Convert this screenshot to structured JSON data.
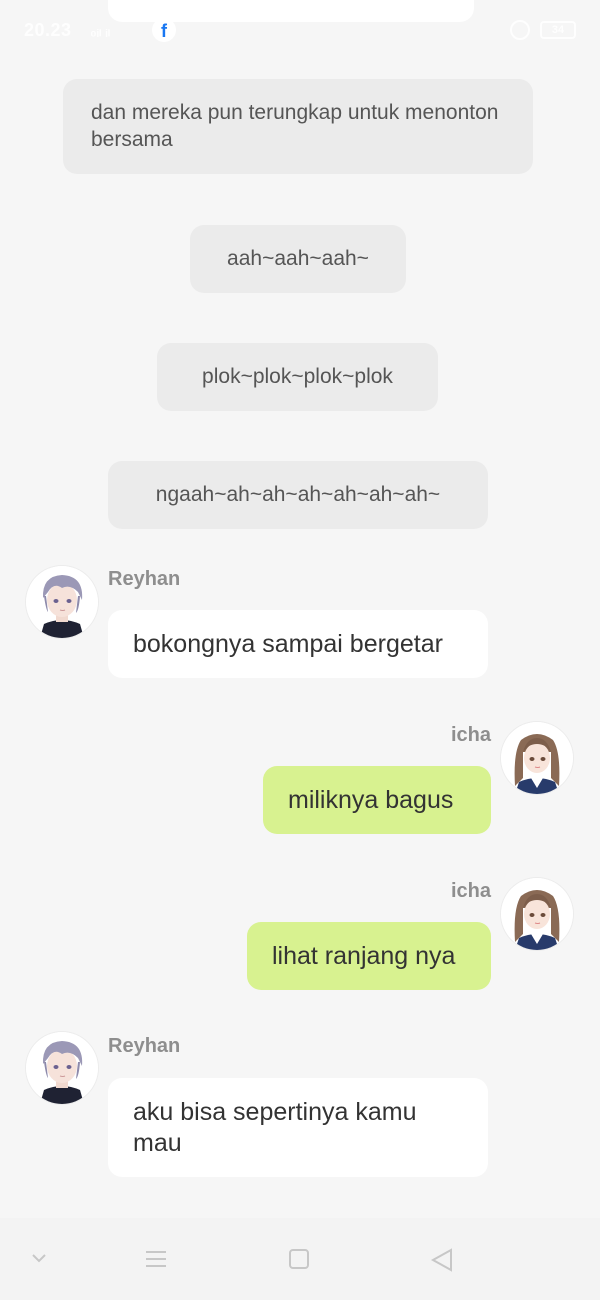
{
  "status_bar": {
    "time": "20.23",
    "signal_text": "₀ᵢₗ ᵢₗ",
    "fb_glyph": "f",
    "battery": "34"
  },
  "narrations": [
    "dan mereka pun terungkap untuk menonton bersama",
    "aah~aah~aah~",
    "plok~plok~plok~plok",
    "ngaah~ah~ah~ah~ah~ah~ah~"
  ],
  "messages": [
    {
      "sender": "Reyhan",
      "text": "bokongnya sampai bergetar",
      "side": "left",
      "avatar": "reyhan-avatar"
    },
    {
      "sender": "icha",
      "text": "miliknya bagus",
      "side": "right",
      "avatar": "icha-avatar"
    },
    {
      "sender": "icha",
      "text": "lihat ranjang nya",
      "side": "right",
      "avatar": "icha-avatar"
    },
    {
      "sender": "Reyhan",
      "text": "aku bisa sepertinya kamu mau",
      "side": "left",
      "avatar": "reyhan-avatar"
    }
  ],
  "colors": {
    "background": "#f6f6f6",
    "narration_bg": "#ebebeb",
    "left_bubble": "#ffffff",
    "right_bubble": "#d8f290",
    "sender_name": "#8e8e8e"
  },
  "nav_bar": {
    "icons": [
      "chevron-down-icon",
      "menu-icon",
      "home-square-icon",
      "back-triangle-icon"
    ]
  }
}
